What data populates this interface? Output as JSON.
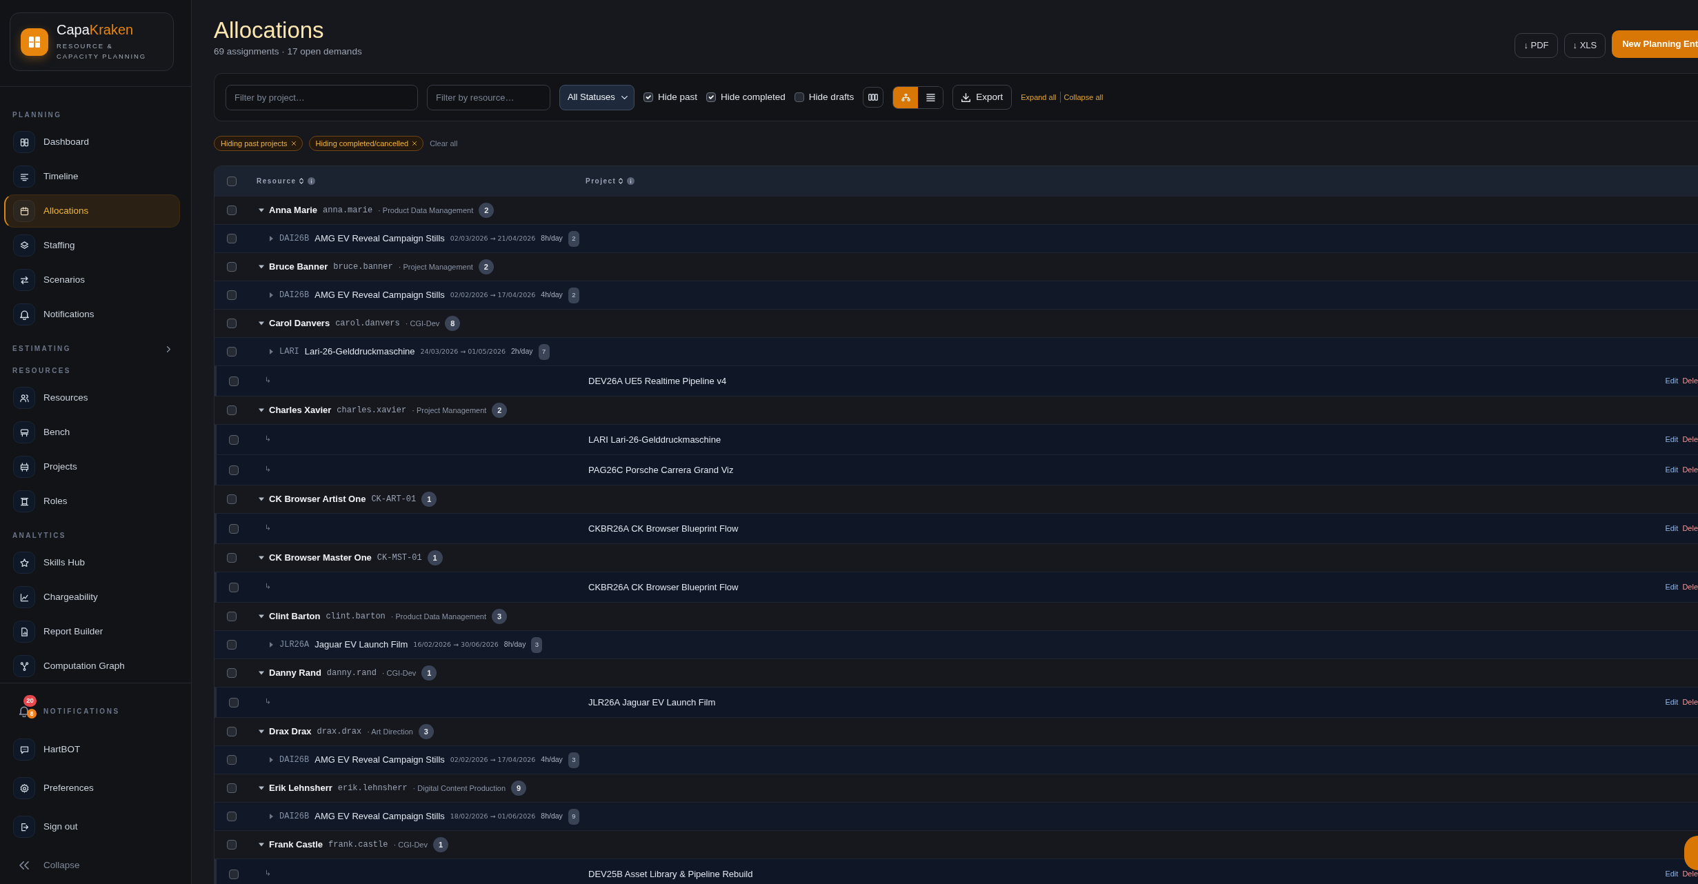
{
  "brand": {
    "name_parts": [
      "Capa",
      "Kraken"
    ],
    "tagline": "RESOURCE & CAPACITY PLANNING"
  },
  "nav": [
    {
      "label": "PLANNING",
      "items": [
        {
          "label": "Dashboard",
          "selected": false
        },
        {
          "label": "Timeline",
          "selected": false
        },
        {
          "label": "Allocations",
          "selected": true
        },
        {
          "label": "Staffing",
          "selected": false
        },
        {
          "label": "Scenarios",
          "selected": false
        },
        {
          "label": "Notifications",
          "selected": false
        }
      ]
    },
    {
      "label": "ESTIMATING",
      "expanded": false
    },
    {
      "label": "RESOURCES",
      "items": [
        {
          "label": "Resources",
          "selected": false
        },
        {
          "label": "Bench",
          "selected": false
        },
        {
          "label": "Projects",
          "selected": false
        },
        {
          "label": "Roles",
          "selected": false
        }
      ]
    },
    {
      "label": "ANALYTICS",
      "items": [
        {
          "label": "Skills Hub",
          "selected": false
        },
        {
          "label": "Chargeability",
          "selected": false
        },
        {
          "label": "Report Builder",
          "selected": false
        },
        {
          "label": "Computation Graph",
          "selected": false
        }
      ]
    }
  ],
  "sidebar_footer": {
    "notifications": {
      "label": "NOTIFICATIONS",
      "unread_count": "20",
      "alert_count": "8"
    },
    "items": [
      {
        "label": "HartBOT"
      },
      {
        "label": "Preferences"
      },
      {
        "label": "Sign out"
      }
    ],
    "collapse": "Collapse"
  },
  "header": {
    "title": "Allocations",
    "subtitle": "69 assignments · 17 open demands",
    "actions": [
      {
        "label": "↓ PDF",
        "kind": "outline"
      },
      {
        "label": "↓ XLS",
        "kind": "outline"
      },
      {
        "label": "New Planning Ent",
        "kind": "primary"
      }
    ]
  },
  "filters": {
    "project": {
      "placeholder": "Filter by project…"
    },
    "resource": {
      "placeholder": "Filter by resource…"
    },
    "status": {
      "value": "All Statuses"
    },
    "toggles": [
      {
        "label": "Hide past",
        "checked": true
      },
      {
        "label": "Hide completed",
        "checked": true
      },
      {
        "label": "Hide drafts",
        "checked": false
      }
    ],
    "view_modes": [
      {
        "selected": true
      },
      {
        "selected": false
      }
    ],
    "export": "Export",
    "expand_all": "Expand all",
    "collapse_all": "Collapse all"
  },
  "active_filters": {
    "chips": [
      {
        "label": "Hiding past projects"
      },
      {
        "label": "Hiding completed/cancelled"
      }
    ],
    "clear": "Clear all"
  },
  "table": {
    "select_all": {
      "checked": false
    },
    "columns": [
      {
        "label": "Resource"
      },
      {
        "label": "Project"
      }
    ],
    "groups": [
      {
        "name": "Anna Marie",
        "username": "anna.marie",
        "department": "· Product Data Management",
        "count": "2",
        "expanded": true,
        "checked": false,
        "children": [
          {
            "kind": "allocation",
            "code": "DAI26B",
            "project": "AMG EV Reveal Campaign Stills",
            "dates": "02/03/2026 → 21/04/2026",
            "rate": "8h/day",
            "count": "2",
            "expanded": false,
            "checked": false
          }
        ]
      },
      {
        "name": "Bruce Banner",
        "username": "bruce.banner",
        "department": "· Project Management",
        "count": "2",
        "expanded": true,
        "checked": false,
        "children": [
          {
            "kind": "allocation",
            "code": "DAI26B",
            "project": "AMG EV Reveal Campaign Stills",
            "dates": "02/02/2026 → 17/04/2026",
            "rate": "4h/day",
            "count": "2",
            "expanded": false,
            "checked": false
          }
        ]
      },
      {
        "name": "Carol Danvers",
        "username": "carol.danvers",
        "department": "· CGI-Dev",
        "count": "8",
        "expanded": true,
        "checked": false,
        "children": [
          {
            "kind": "allocation",
            "code": "LARI",
            "project": "Lari-26-Gelddruckmaschine",
            "dates": "24/03/2026 → 01/05/2026",
            "rate": "2h/day",
            "count": "7",
            "expanded": false,
            "checked": false
          },
          {
            "kind": "demand",
            "marker": "↳",
            "project": "DEV26A UE5 Realtime Pipeline v4",
            "edit": "Edit",
            "delete": "Dele",
            "checked": false
          }
        ]
      },
      {
        "name": "Charles Xavier",
        "username": "charles.xavier",
        "department": "· Project Management",
        "count": "2",
        "expanded": true,
        "checked": false,
        "children": [
          {
            "kind": "demand",
            "marker": "↳",
            "project": "LARI Lari-26-Gelddruckmaschine",
            "edit": "Edit",
            "delete": "Dele",
            "checked": false
          },
          {
            "kind": "demand",
            "marker": "↳",
            "project": "PAG26C Porsche Carrera Grand Viz",
            "edit": "Edit",
            "delete": "Dele",
            "checked": false
          }
        ]
      },
      {
        "name": "CK Browser Artist One",
        "username": "CK-ART-01",
        "count": "1",
        "expanded": true,
        "checked": false,
        "children": [
          {
            "kind": "demand",
            "marker": "↳",
            "project": "CKBR26A CK Browser Blueprint Flow",
            "edit": "Edit",
            "delete": "Dele",
            "checked": false
          }
        ]
      },
      {
        "name": "CK Browser Master One",
        "username": "CK-MST-01",
        "count": "1",
        "expanded": true,
        "checked": false,
        "children": [
          {
            "kind": "demand",
            "marker": "↳",
            "project": "CKBR26A CK Browser Blueprint Flow",
            "edit": "Edit",
            "delete": "Dele",
            "checked": false
          }
        ]
      },
      {
        "name": "Clint Barton",
        "username": "clint.barton",
        "department": "· Product Data Management",
        "count": "3",
        "expanded": true,
        "checked": false,
        "children": [
          {
            "kind": "allocation",
            "code": "JLR26A",
            "project": "Jaguar EV Launch Film",
            "dates": "16/02/2026 → 30/06/2026",
            "rate": "8h/day",
            "count": "3",
            "expanded": false,
            "checked": false
          }
        ]
      },
      {
        "name": "Danny Rand",
        "username": "danny.rand",
        "department": "· CGI-Dev",
        "count": "1",
        "expanded": true,
        "checked": false,
        "children": [
          {
            "kind": "demand",
            "marker": "↳",
            "project": "JLR26A Jaguar EV Launch Film",
            "edit": "Edit",
            "delete": "Dele",
            "checked": false
          }
        ]
      },
      {
        "name": "Drax Drax",
        "username": "drax.drax",
        "department": "· Art Direction",
        "count": "3",
        "expanded": true,
        "checked": false,
        "children": [
          {
            "kind": "allocation",
            "code": "DAI26B",
            "project": "AMG EV Reveal Campaign Stills",
            "dates": "02/02/2026 → 17/04/2026",
            "rate": "4h/day",
            "count": "3",
            "expanded": false,
            "checked": false
          }
        ]
      },
      {
        "name": "Erik Lehnsherr",
        "username": "erik.lehnsherr",
        "department": "· Digital Content Production",
        "count": "9",
        "expanded": true,
        "checked": false,
        "children": [
          {
            "kind": "allocation",
            "code": "DAI26B",
            "project": "AMG EV Reveal Campaign Stills",
            "dates": "18/02/2026 → 01/06/2026",
            "rate": "8h/day",
            "count": "9",
            "expanded": false,
            "checked": false
          }
        ]
      },
      {
        "name": "Frank Castle",
        "username": "frank.castle",
        "department": "· CGI-Dev",
        "count": "1",
        "expanded": true,
        "checked": false,
        "children": [
          {
            "kind": "demand",
            "marker": "↳",
            "project": "DEV25B Asset Library & Pipeline Rebuild",
            "edit": "Edit",
            "delete": "Dele",
            "checked": false
          }
        ]
      }
    ]
  }
}
